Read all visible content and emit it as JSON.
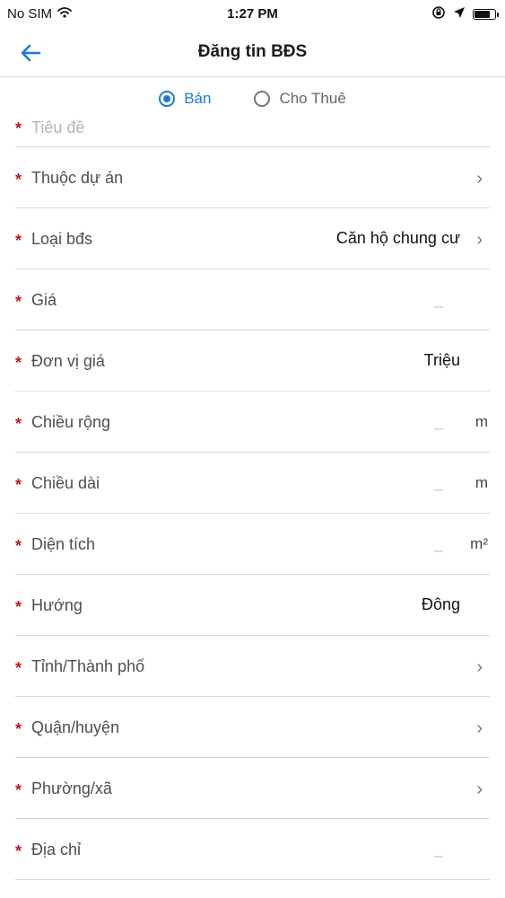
{
  "statusbar": {
    "carrier": "No SIM",
    "time": "1:27 PM"
  },
  "header": {
    "title": "Đăng tin BĐS",
    "icons": [
      "back-arrow-icon"
    ]
  },
  "listing_type": {
    "options": [
      "Bán",
      "Cho Thuê"
    ],
    "selected": "Bán"
  },
  "fields": [
    {
      "label": "Tiêu đề",
      "required": true,
      "value": "",
      "placeholder": ""
    },
    {
      "label": "Thuộc dự án",
      "required": true,
      "value": "",
      "icon": "chevron-right-icon"
    },
    {
      "label": "Loại bđs",
      "required": true,
      "value": "Căn hộ chung cư",
      "icon": "chevron-right-icon"
    },
    {
      "label": "Giá",
      "required": true,
      "value": "",
      "placeholder": "_"
    },
    {
      "label": "Đơn vị giá",
      "required": true,
      "value": "Triệu"
    },
    {
      "label": "Chiều rộng",
      "required": true,
      "value": "",
      "placeholder": "_",
      "unit": "m"
    },
    {
      "label": "Chiều dài",
      "required": true,
      "value": "",
      "placeholder": "_",
      "unit": "m"
    },
    {
      "label": "Diện tích",
      "required": true,
      "value": "",
      "placeholder": "_",
      "unit": "m²"
    },
    {
      "label": "Hướng",
      "required": true,
      "value": "Đông"
    },
    {
      "label": "Tỉnh/Thành phố",
      "required": true,
      "value": "",
      "icon": "chevron-right-icon"
    },
    {
      "label": "Quận/huyện",
      "required": true,
      "value": "",
      "icon": "chevron-right-icon"
    },
    {
      "label": "Phường/xã",
      "required": true,
      "value": "",
      "icon": "chevron-right-icon"
    },
    {
      "label": "Địa chỉ",
      "required": true,
      "value": "",
      "placeholder": "_"
    }
  ],
  "colors": {
    "accent": "#1e7ad8",
    "required": "#c4161c",
    "divider": "#d9d9d9"
  }
}
